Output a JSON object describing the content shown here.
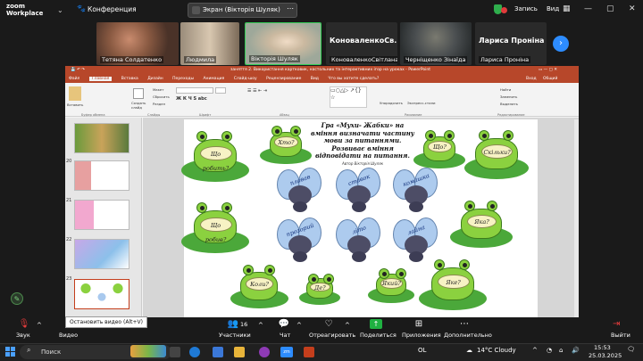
{
  "app": {
    "logo_line1": "zoom",
    "logo_line2": "Workplace",
    "meeting_label": "Конференция"
  },
  "screen_share_tab": {
    "label": "Экран (Вікторія Шуляк)"
  },
  "top_right": {
    "record_label": "Запись",
    "view_label": "Вид"
  },
  "participants": [
    {
      "name": "Тетяна Солдатенко",
      "color": "#6e4a3a"
    },
    {
      "name": "Людмила",
      "color": "#7d6a55"
    },
    {
      "name": "Вікторія Шуляк",
      "color": "#c8c4b8"
    },
    {
      "name": "КоноваленкоСвітлана",
      "big": "КоноваленкоСв...",
      "color": "#2a2a2a"
    },
    {
      "name": "Черніщенко Зінаїда",
      "color": "#5a5e5e"
    },
    {
      "name": "Лариса Проніна",
      "big": "Лариса Проніна",
      "color": "#2a2a2a"
    }
  ],
  "ppt": {
    "window_title": "заняття 2. Використання картковик, настольних та інтерактивних ігор на уроках - PowerPoint",
    "tabs": [
      "Файл",
      "Главная",
      "Вставка",
      "Дизайн",
      "Переходы",
      "Анимация",
      "Слайд-шоу",
      "Рецензирование",
      "Вид",
      "Что вы хотите сделать?"
    ],
    "right_tabs": [
      "Вход",
      "Общий доступ"
    ],
    "ribbon_groups": [
      "Буфер обмена",
      "Слайды",
      "Шрифт",
      "Абзац",
      "Рисование",
      "Редактирование"
    ],
    "ribbon_buttons": [
      "Вставить",
      "Создать слайд",
      "Макет",
      "Сбросить",
      "Раздел",
      "Упорядочить",
      "Экспресс-стили",
      "Найти",
      "Заменить",
      "Выделить"
    ],
    "slide_numbers": [
      "20",
      "21",
      "22",
      "23"
    ]
  },
  "slide": {
    "title": "Гра «Мухи- Жабки» на вміння визначати частину мови за питаннями. Розвиває вміння відповідати на питання.",
    "author": "Автор Вікторія Шуляк",
    "questions": [
      "Що робить?",
      "Хто?",
      "Що?",
      "Скільки?",
      "Що робив?",
      "Яка?",
      "Коли?",
      "Де?",
      "Який?",
      "Яке?"
    ],
    "words": [
      "плавав",
      "ставок",
      "комашка",
      "прозорий",
      "літо",
      "лайна"
    ]
  },
  "controls": {
    "audio": "Звук",
    "video": "Видео",
    "participants": "Участники",
    "participants_count": "16",
    "chat": "Чат",
    "react": "Отреагировать",
    "share": "Поделиться",
    "apps": "Приложения",
    "more": "Дополнительно",
    "leave": "Выйти",
    "tooltip": "Остановить видео (Alt+V)"
  },
  "taskbar": {
    "search": "Поиск",
    "lang": "OL",
    "weather": "14°C Cloudy",
    "time": "15:53",
    "date": "25.03.2025"
  }
}
